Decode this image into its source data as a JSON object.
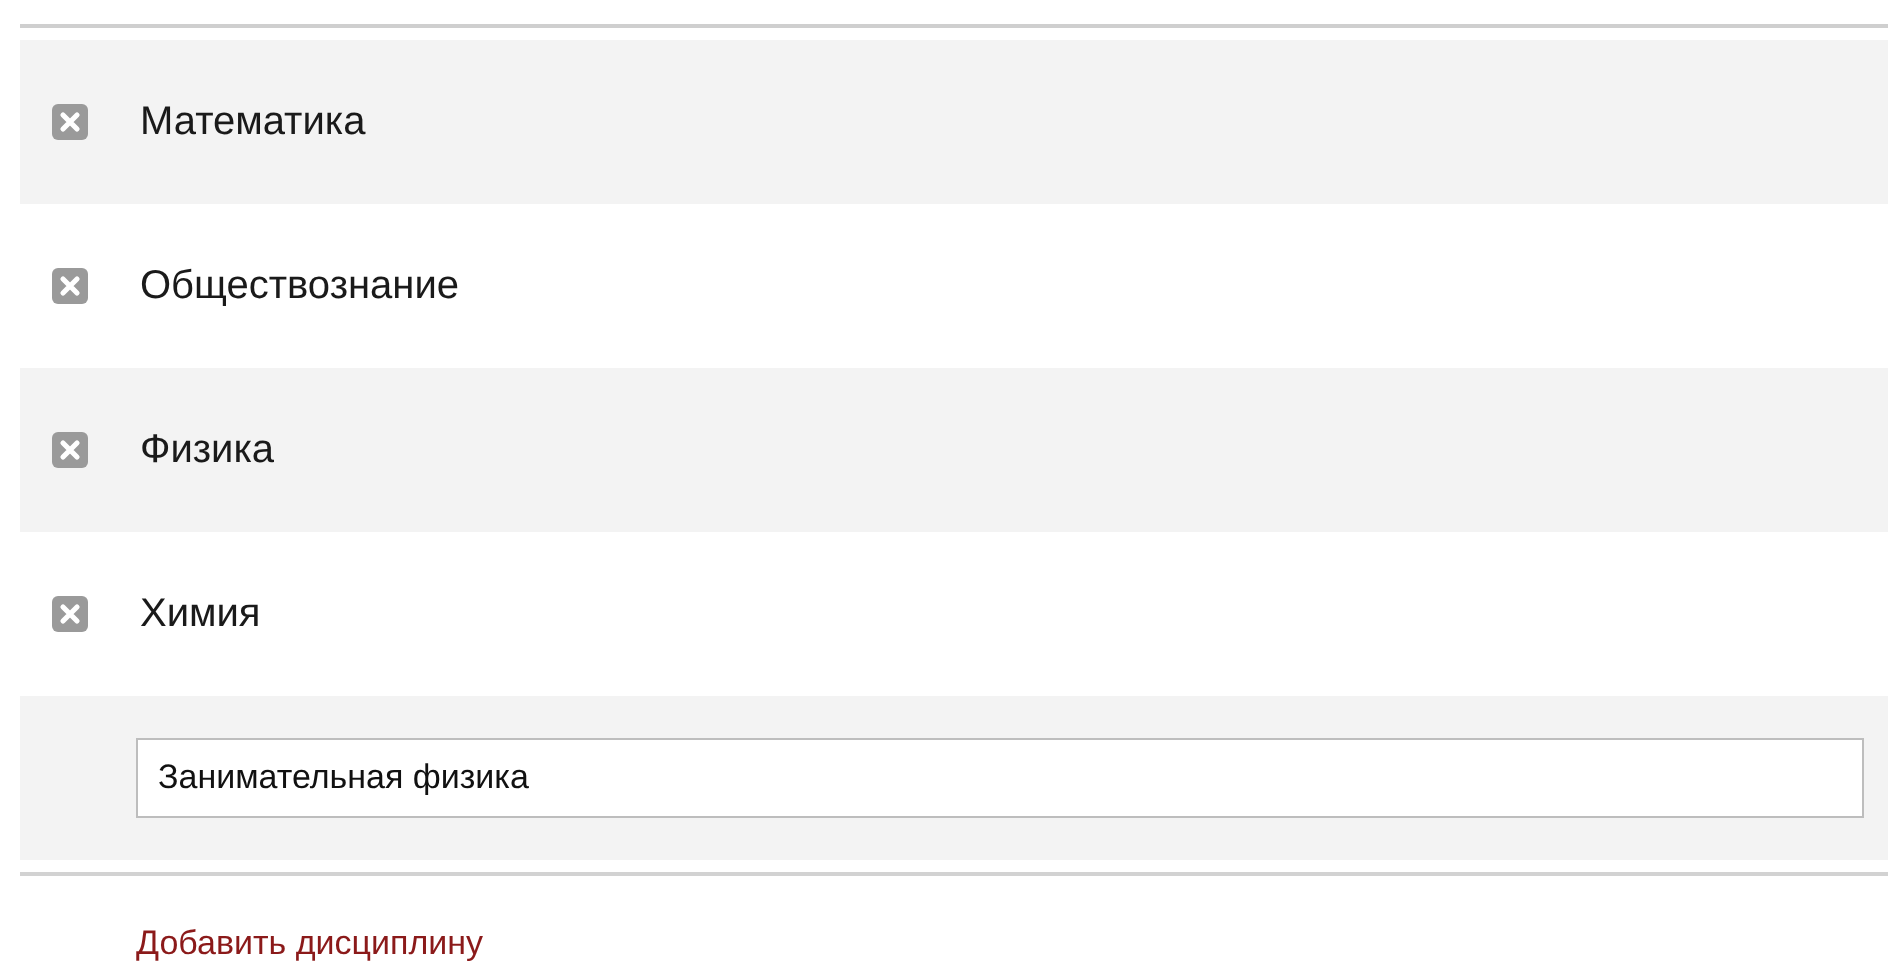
{
  "subjects": [
    {
      "name": "Математика"
    },
    {
      "name": "Обществознание"
    },
    {
      "name": "Физика"
    },
    {
      "name": "Химия"
    }
  ],
  "new_subject": {
    "value": "Занимательная физика"
  },
  "add_link": "Добавить дисциплину"
}
